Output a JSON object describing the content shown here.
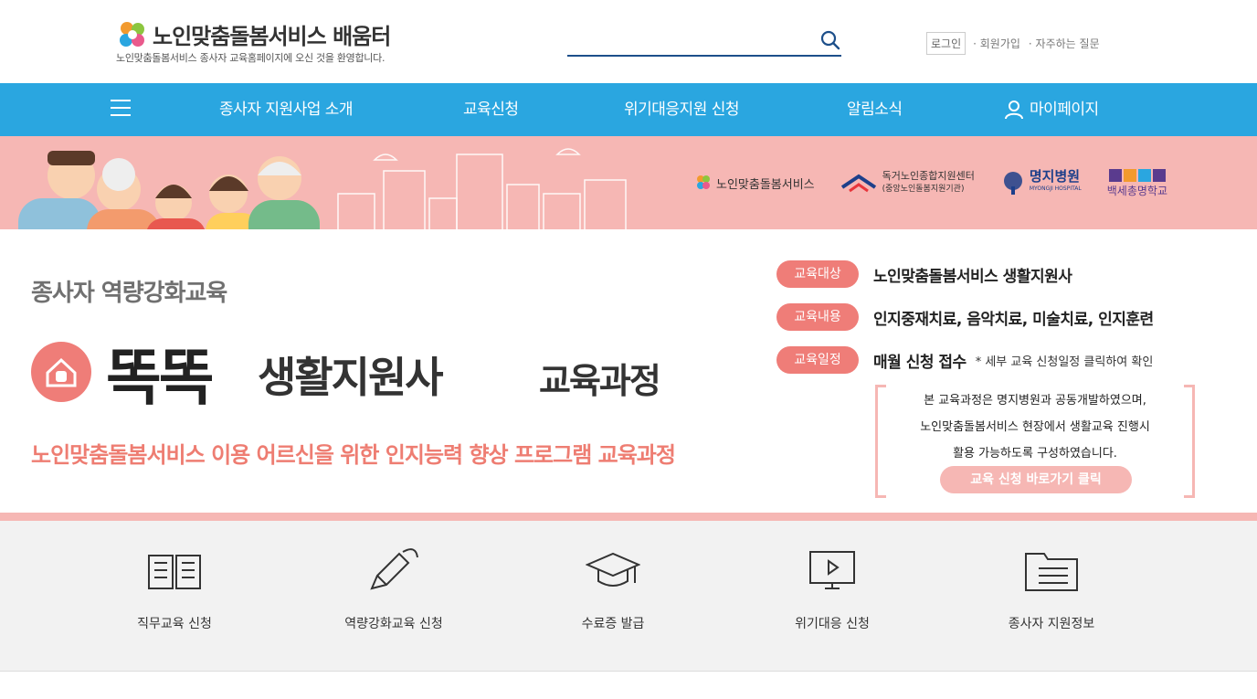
{
  "header": {
    "logo_title": "노인맞춤돌봄서비스 배움터",
    "logo_subtitle": "노인맞춤돌봄서비스 종사자 교육홈페이지에 오신 것을 환영합니다.",
    "search_placeholder": "",
    "util": {
      "login": "로그인",
      "signup": "· 회원가입",
      "faq": "· 자주하는 질문"
    }
  },
  "nav": {
    "items": [
      {
        "label": "종사자 지원사업 소개"
      },
      {
        "label": "교육신청"
      },
      {
        "label": "위기대응지원 신청"
      },
      {
        "label": "알림소식"
      },
      {
        "label": "마이페이지"
      }
    ],
    "bg_color": "#2aa6e0"
  },
  "banner": {
    "partners": [
      {
        "name": "노인맞춤돌봄서비스"
      },
      {
        "name": "독거노인종합지원센터",
        "sub": "(중앙노인돌봄지원기관)"
      },
      {
        "name": "명지병원",
        "sub": "MYONGJI HOSPITAL"
      },
      {
        "name": "백세총명학교"
      }
    ],
    "small_title": "종사자 역량강화교육",
    "big_title": "똑똑",
    "mid_title": "생활지원사",
    "tail_title": "교육과정",
    "description": "노인맞춤돌봄서비스 이용 어르신을 위한 인지능력 향상 프로그램 교육과정",
    "info": [
      {
        "label": "교육대상",
        "value": "노인맞춤돌봄서비스 생활지원사",
        "note": ""
      },
      {
        "label": "교육내용",
        "value": "인지중재치료, 음악치료, 미술치료, 인지훈련",
        "note": ""
      },
      {
        "label": "교육일정",
        "value": "매월 신청 접수",
        "note": "* 세부 교육 신청일정 클릭하여 확인"
      }
    ],
    "box_lines": [
      "본 교육과정은 명지병원과 공동개발하였으며,",
      "노인맞춤돌봄서비스 현장에서 생활교육 진행시",
      "활용 가능하도록 구성하였습니다."
    ],
    "apply_button": "교육 신청 바로가기 클릭",
    "accent_color": "#ef7d78",
    "pink_color": "#f6b7b4"
  },
  "quick_menu": [
    {
      "label": "직무교육 신청",
      "icon": "book-icon"
    },
    {
      "label": "역량강화교육 신청",
      "icon": "pencil-icon"
    },
    {
      "label": "수료증 발급",
      "icon": "graduation-cap-icon"
    },
    {
      "label": "위기대응 신청",
      "icon": "monitor-play-icon"
    },
    {
      "label": "종사자 지원정보",
      "icon": "folder-list-icon"
    }
  ]
}
